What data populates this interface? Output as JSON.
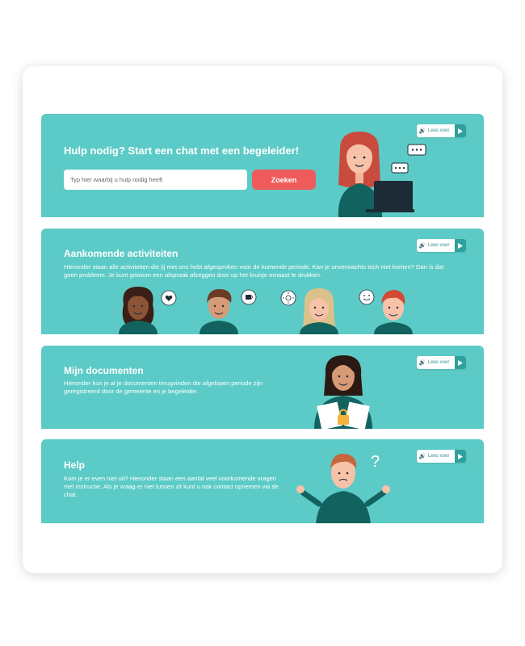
{
  "colors": {
    "panel": "#5ccbc7",
    "accent_red": "#ef5b5b",
    "dark_teal": "#12635f",
    "play": "#2fa09b"
  },
  "read_aloud": {
    "label": "Lees voor",
    "speaker_icon": "speaker-icon",
    "play_icon": "play-icon"
  },
  "chat": {
    "title": "Hulp nodig? Start een chat met een begeleider!",
    "search_placeholder": "Typ hier waarbij u hulp nodig heeft",
    "search_button": "Zoeken",
    "chat_bubble_icon": "chat-bubble-icon"
  },
  "activities": {
    "title": "Aankomende activiteiten",
    "description": "Hieronder staan alle activiteiten die jij met ons hebt afgesproken voor de komende periode. Kan je onverwachts toch niet komen? Dan is dat geen probleem. Je kunt gewoon een afspraak afzeggen door op het kruisje ernaast te drukken.",
    "bubble_icons": [
      "heart-icon",
      "coffee-icon",
      "sun-icon",
      "smiley-icon"
    ]
  },
  "documents": {
    "title": "Mijn documenten",
    "description": "Hieronder kun je al je documenten terugvinden die afgelopen periode zijn geregistreerd door de gemeente en je begeleider.",
    "lock_icon": "lock-icon"
  },
  "help": {
    "title": "Help",
    "description": "Kom je er even niet uit? Hieronder staan een aantal veel voorkomende vragen met instructie. Als je vraag er niet tussen zit kunt u ook contact opnemen via de chat.",
    "question_mark": "?"
  }
}
